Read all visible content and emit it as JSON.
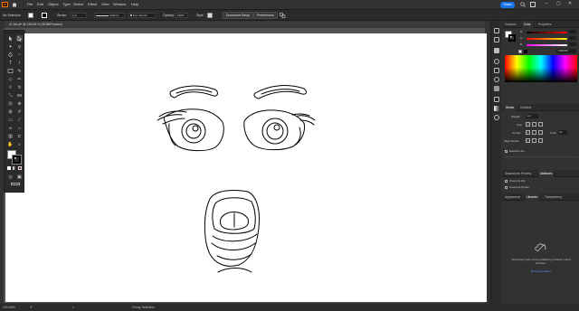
{
  "menubar": {
    "logo_text": "Ai",
    "items": [
      "File",
      "Edit",
      "Object",
      "Type",
      "Select",
      "Effect",
      "View",
      "Window",
      "Help"
    ],
    "share_label": "Share"
  },
  "controlbar": {
    "selection_label": "No Selection",
    "stroke_label": "Stroke:",
    "stroke_value": "1 pt",
    "uniform_label": "Uniform",
    "brush_label": "5 pt. Round",
    "opacity_label": "Opacity:",
    "opacity_value": "100%",
    "style_label": "Style:",
    "doc_setup_label": "Document Setup",
    "preferences_label": "Preferences"
  },
  "document": {
    "tab_label": "47 Art.ai* @ 159.66 % (RGB/Preview)"
  },
  "statusbar": {
    "zoom": "159.66%",
    "rotation": "0°",
    "artboard_nav": "1",
    "tool_name": "Group Selection"
  },
  "panels": {
    "top_tabs": [
      "Gradient",
      "Color",
      "Properties"
    ],
    "active_top_tab": "Color",
    "hex_value": "FFFFFF",
    "stroke_tabs": [
      "Stroke",
      "Gradient"
    ],
    "stroke": {
      "weight_label": "Weight:",
      "weight_value": "1 pt",
      "cap_label": "Cap:",
      "corner_label": "Corner:",
      "limit_label": "Limit:",
      "limit_value": "10",
      "align_label": "Align Stroke:",
      "dashed_label": "Dashed Line"
    },
    "transparency_tabs": [
      "Separations Preview",
      "Attributes"
    ],
    "active_transparency_tab": "Attributes",
    "overprint_fill": "Overprint Fill",
    "overprint_stroke": "Overprint Stroke",
    "bottom_tabs": [
      "Appearance",
      "Libraries",
      "Transparency"
    ],
    "active_bottom_tab": "Libraries",
    "library_message": "Something went wrong initializing Creative Cloud libraries.",
    "library_link": "More information"
  },
  "colors": {
    "accent": "#1473e6",
    "logo_orange": "#ff7c00",
    "panel_bg": "#323232",
    "artboard": "#ffffff"
  }
}
